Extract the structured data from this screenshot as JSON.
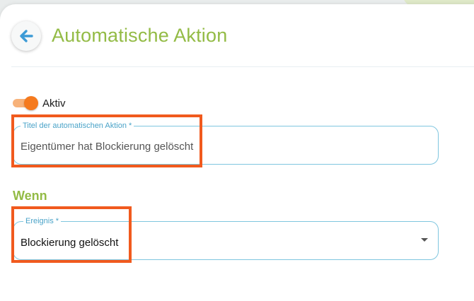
{
  "header": {
    "title": "Automatische Aktion",
    "back_icon": "arrow-left-icon"
  },
  "colors": {
    "accent_green": "#93bb45",
    "toggle_orange": "#f57a1e",
    "field_border": "#7fc6df",
    "highlight_orange": "#f15a1e"
  },
  "toggle": {
    "label": "Aktiv",
    "checked": true
  },
  "title_field": {
    "label": "Titel der automatischen Aktion *",
    "value": "Eigentümer hat Blockierung gelöscht"
  },
  "when_section": {
    "heading": "Wenn"
  },
  "event_field": {
    "label": "Ereignis *",
    "value": "Blockierung gelöscht",
    "icon": "dropdown-arrow-icon"
  }
}
